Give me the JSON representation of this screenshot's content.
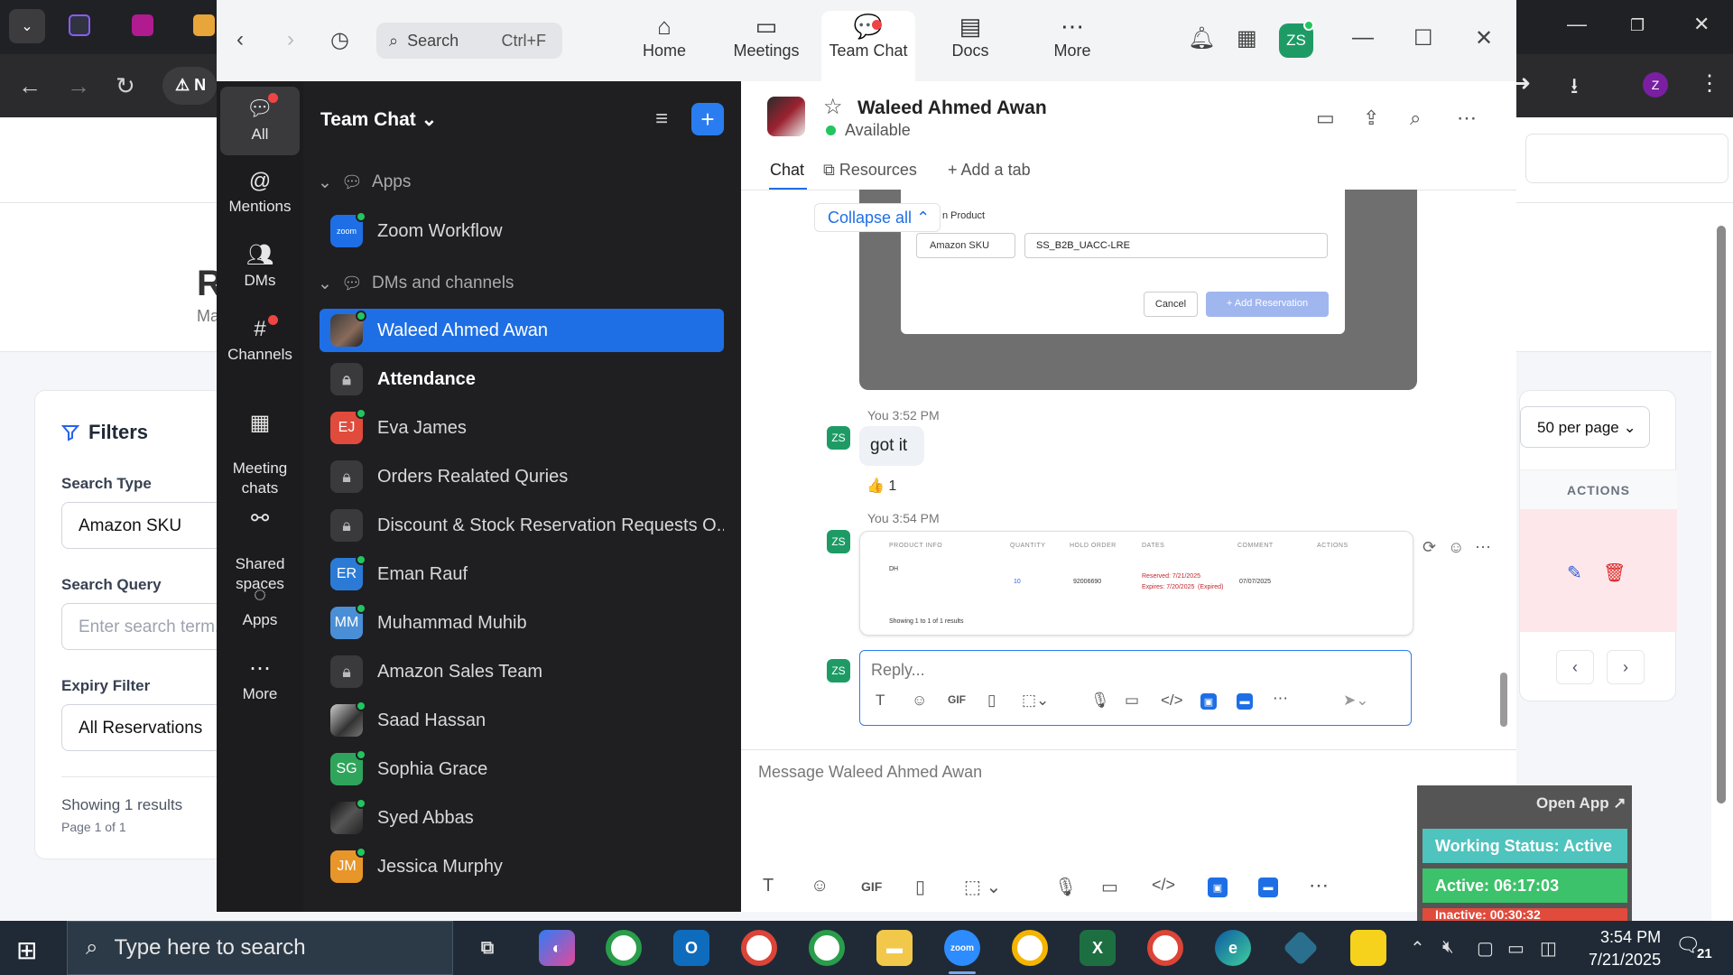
{
  "browser": {
    "address_partial": "N",
    "avatar_letter": "Z"
  },
  "webapp": {
    "page_title_partial": "R",
    "page_subtitle_partial": "Ma",
    "filters": {
      "title": "Filters",
      "search_type_label": "Search Type",
      "search_type_value": "Amazon SKU",
      "search_query_label": "Search Query",
      "search_query_placeholder": "Enter search term...",
      "expiry_label": "Expiry Filter",
      "expiry_value": "All Reservations",
      "showing": "Showing 1 results",
      "page": "Page 1 of 1"
    },
    "per_page": "50 per page",
    "actions_header": "ACTIONS"
  },
  "zoom": {
    "search_label": "Search",
    "search_shortcut": "Ctrl+F",
    "top_tabs": [
      {
        "label": "Home",
        "icon": "home-icon"
      },
      {
        "label": "Meetings",
        "icon": "video-icon"
      },
      {
        "label": "Team Chat",
        "icon": "chat-icon"
      },
      {
        "label": "Docs",
        "icon": "doc-icon"
      },
      {
        "label": "More",
        "icon": "more-icon"
      }
    ],
    "profile_initials": "ZS",
    "rail": [
      {
        "label": "All"
      },
      {
        "label": "Mentions"
      },
      {
        "label": "DMs"
      },
      {
        "label": "Channels"
      },
      {
        "label": "Meeting\nchats"
      },
      {
        "label": "Shared\nspaces"
      },
      {
        "label": "Apps"
      },
      {
        "label": "More"
      }
    ],
    "list_title": "Team Chat",
    "sections": {
      "apps": "Apps",
      "dms": "DMs and channels"
    },
    "apps_items": [
      {
        "name": "Zoom Workflow",
        "badge": "zoom"
      }
    ],
    "items": [
      {
        "name": "Waleed Ahmed Awan"
      },
      {
        "name": "Attendance"
      },
      {
        "name": "Eva James",
        "initials": "EJ"
      },
      {
        "name": "Orders Realated Quries"
      },
      {
        "name": "Discount & Stock Reservation Requests O..."
      },
      {
        "name": "Eman Rauf",
        "initials": "ER"
      },
      {
        "name": "Muhammad Muhib",
        "initials": "MM"
      },
      {
        "name": "Amazon Sales Team"
      },
      {
        "name": "Saad Hassan"
      },
      {
        "name": "Sophia Grace",
        "initials": "SG"
      },
      {
        "name": "Syed Abbas"
      },
      {
        "name": "Jessica Murphy",
        "initials": "JM"
      }
    ],
    "conversation": {
      "name": "Waleed Ahmed Awan",
      "status": "Available",
      "tabs": {
        "chat": "Chat",
        "resources": "Resources",
        "add": "Add a tab"
      },
      "collapse_all": "Collapse all",
      "screenshot1": {
        "label": "n Product",
        "select": "Amazon SKU",
        "input": "SS_B2B_UACC-LRE",
        "cancel": "Cancel",
        "add": "+ Add Reservation"
      },
      "messages": [
        {
          "sender": "You",
          "time": "3:52 PM",
          "text": "got it",
          "reaction": "👍 1"
        },
        {
          "sender": "You",
          "time": "3:54 PM"
        }
      ],
      "screenshot2": {
        "headers": [
          "PRODUCT INFO",
          "QUANTITY",
          "HOLD ORDER",
          "DATES",
          "COMMENT",
          "ACTIONS"
        ],
        "product": "DH",
        "qty": "10",
        "order": "92006690",
        "reserved": "Reserved: 7/21/2025",
        "expires": "Expires: 7/20/2025",
        "expired_tag": "(Expired)",
        "comment": "07/07/2025",
        "footer": "Showing 1 to 1 of 1 results"
      },
      "reply_placeholder": "Reply...",
      "compose_placeholder": "Message Waleed Ahmed Awan",
      "avatar_initials": "ZS"
    }
  },
  "widget": {
    "open_app": "Open App ↗",
    "status": "Working Status: Active",
    "active": "Active: 06:17:03",
    "inactive_partial": "Inactive: 00:30:32"
  },
  "taskbar": {
    "search_placeholder": "Type here to search",
    "time": "3:54 PM",
    "date": "7/21/2025",
    "notifications": "21"
  }
}
